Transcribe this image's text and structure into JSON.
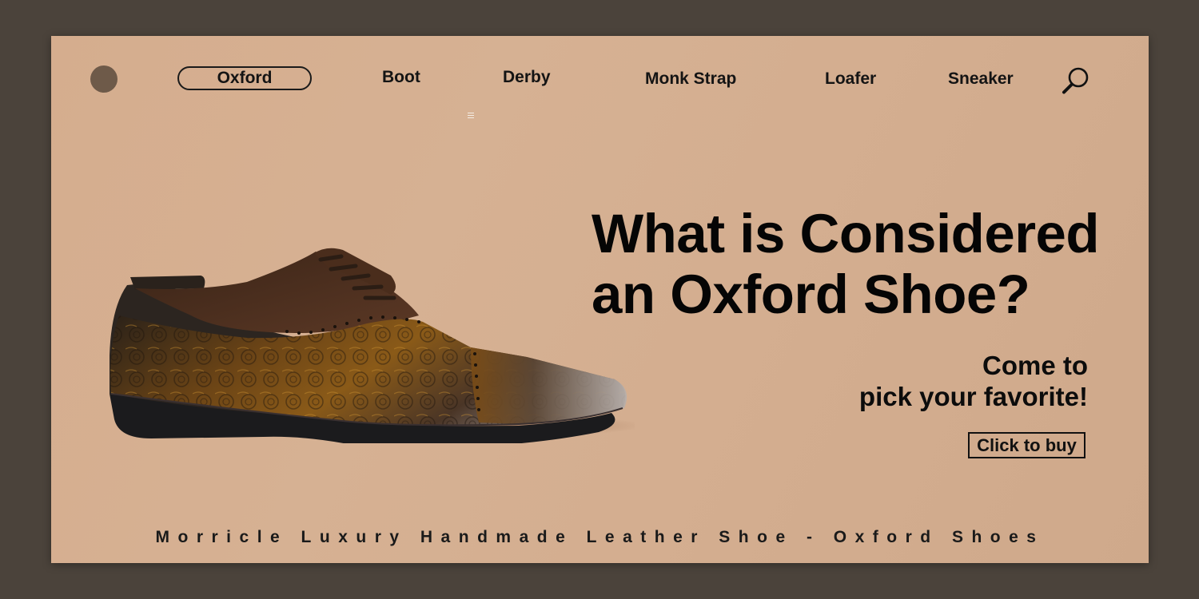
{
  "nav": {
    "items": [
      {
        "label": "Oxford",
        "active": true
      },
      {
        "label": "Boot"
      },
      {
        "label": "Derby"
      },
      {
        "label": "Monk Strap"
      },
      {
        "label": "Loafer"
      },
      {
        "label": "Sneaker"
      }
    ],
    "search_icon": "search-icon",
    "menu_icon": "menu-icon"
  },
  "hero": {
    "title_line1": "What is Considered",
    "title_line2": "an Oxford Shoe?",
    "subtitle_line1": "Come to",
    "subtitle_line2": "pick your favorite!",
    "cta_label": "Click to buy"
  },
  "footer": {
    "text": "Morricle Luxury Handmade Leather Shoe - Oxford Shoes"
  },
  "colors": {
    "background": "#4b433b",
    "panel": "#d5ad8e",
    "logo_dot": "#6e5a49",
    "text": "#0a0a0a"
  }
}
